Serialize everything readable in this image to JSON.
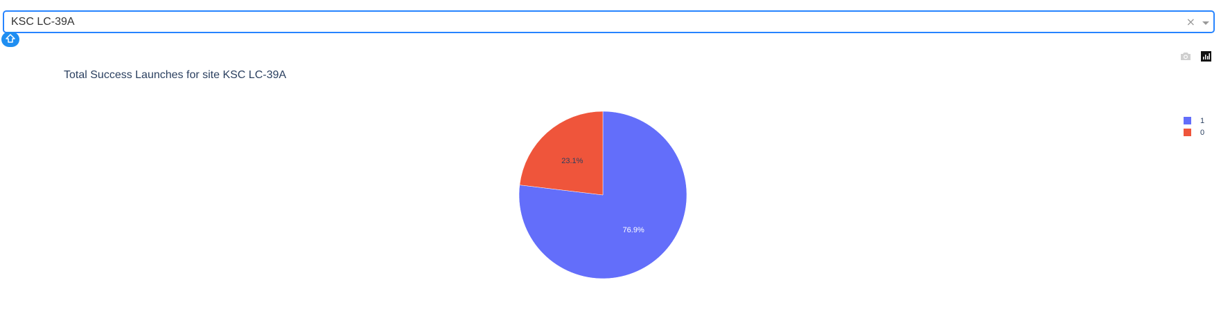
{
  "dropdown": {
    "value": "KSC LC-39A",
    "clear_symbol": "×"
  },
  "chart_data": {
    "type": "pie",
    "title": "Total Success Launches for site KSC LC-39A",
    "categories": [
      "1",
      "0"
    ],
    "values": [
      76.9,
      23.1
    ],
    "labels": [
      "76.9%",
      "23.1%"
    ],
    "colors": [
      "#636efa",
      "#ef553b"
    ],
    "label_colors": [
      "#ffffff",
      "#2a3f5f"
    ],
    "legend_placement": "top-right"
  },
  "modebar": {
    "icons": [
      "camera-icon",
      "plotly-logo-icon"
    ]
  }
}
